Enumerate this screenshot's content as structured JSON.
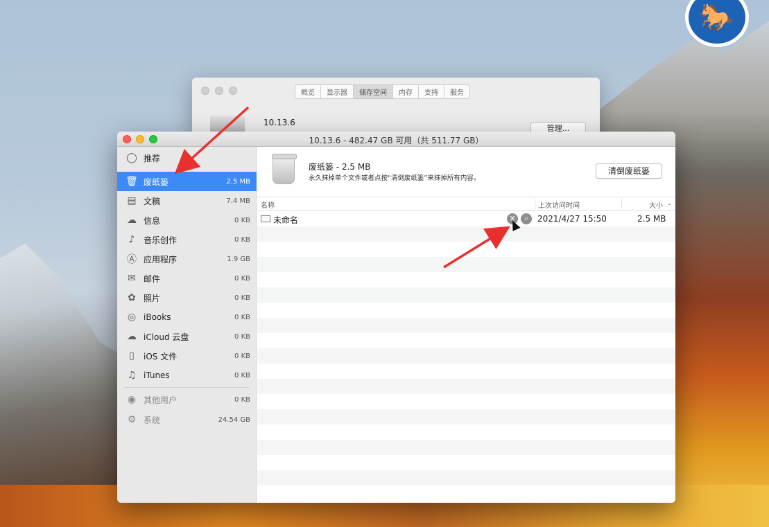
{
  "colors": {
    "selection": "#3d8af7",
    "annotation_arrow": "#e8312f",
    "close_light": "#fc5f57",
    "minimize_light": "#fdbc2e",
    "maximize_light": "#28c840"
  },
  "back_window": {
    "tabs": [
      {
        "label": "概览"
      },
      {
        "label": "显示器"
      },
      {
        "label": "储存空间",
        "active": true
      },
      {
        "label": "内存"
      },
      {
        "label": "支持"
      },
      {
        "label": "服务"
      }
    ],
    "version": "10.13.6",
    "manage_button": "管理..."
  },
  "window": {
    "title": "10.13.6 - 482.47 GB 可用（共 511.77 GB）"
  },
  "sidebar": {
    "items": [
      {
        "label": "推荐",
        "size": "",
        "icon": "lightbulb-icon"
      },
      {
        "label": "废纸篓",
        "size": "2.5 MB",
        "icon": "trash-icon",
        "selected": true
      },
      {
        "label": "文稿",
        "size": "7.4 MB",
        "icon": "document-icon"
      },
      {
        "label": "信息",
        "size": "0 KB",
        "icon": "messages-icon"
      },
      {
        "label": "音乐创作",
        "size": "0 KB",
        "icon": "guitar-icon"
      },
      {
        "label": "应用程序",
        "size": "1.9 GB",
        "icon": "app-store-icon"
      },
      {
        "label": "邮件",
        "size": "0 KB",
        "icon": "mail-icon"
      },
      {
        "label": "照片",
        "size": "0 KB",
        "icon": "photos-icon"
      },
      {
        "label": "iBooks",
        "size": "0 KB",
        "icon": "book-icon"
      },
      {
        "label": "iCloud 云盘",
        "size": "0 KB",
        "icon": "cloud-icon"
      },
      {
        "label": "iOS 文件",
        "size": "0 KB",
        "icon": "phone-icon"
      },
      {
        "label": "iTunes",
        "size": "0 KB",
        "icon": "music-note-icon"
      },
      {
        "label": "其他用户",
        "size": "0 KB",
        "icon": "users-icon"
      },
      {
        "label": "系统",
        "size": "24.54 GB",
        "icon": "gear-icon"
      }
    ]
  },
  "content": {
    "header_title": "废纸篓 - 2.5 MB",
    "header_desc": "永久抹掉单个文件或者点按“清倒废纸篓”来抹掉所有内容。",
    "empty_button": "清倒废纸篓",
    "columns": {
      "name": "名称",
      "last_access": "上次访问时间",
      "size": "大小"
    },
    "files": [
      {
        "name": "未命名",
        "last_access": "2021/4/27 15:50",
        "size": "2.5 MB"
      }
    ]
  }
}
